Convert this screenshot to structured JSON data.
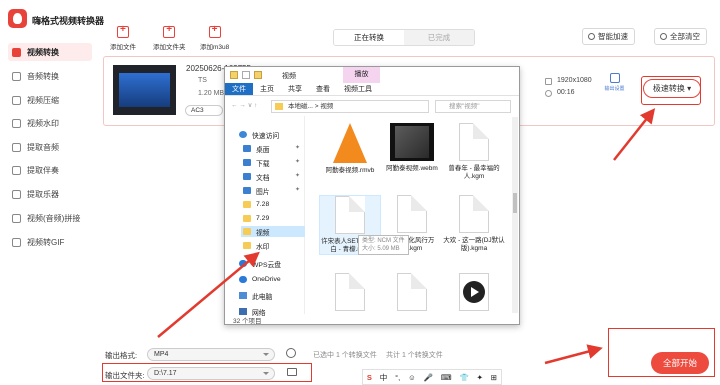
{
  "app": {
    "title": "嗨格式视频转换器"
  },
  "sidebar": {
    "items": [
      {
        "label": "视频转换",
        "active": true
      },
      {
        "label": "音频转换"
      },
      {
        "label": "视频压缩"
      },
      {
        "label": "视频水印"
      },
      {
        "label": "提取音频"
      },
      {
        "label": "提取伴奏"
      },
      {
        "label": "提取乐器"
      },
      {
        "label": "视频(音频)拼接"
      },
      {
        "label": "视频转GIF"
      }
    ]
  },
  "toolbar": {
    "add_file": "添加文件",
    "add_folder": "添加文件夹",
    "add_m3u8": "添加m3u8",
    "tab_converting": "正在转换",
    "tab_done": "已完成",
    "smart_accel": "智能加速",
    "clear_all": "全部清空"
  },
  "file": {
    "name": "20250626-162755",
    "type": "TS",
    "size": "1.20 MB",
    "codec": "AC3",
    "resolution": "1920x1080",
    "duration": "00:16",
    "output_settings": "输出设置",
    "fast_convert": "极速转换"
  },
  "bottom": {
    "format_label": "输出格式:",
    "format_value": "MP4",
    "folder_label": "输出文件夹:",
    "folder_value": "D:\\7.17",
    "selected_status": "已选中 1 个转换文件",
    "total_status": "共计 1 个转换文件",
    "start_all": "全部开始"
  },
  "ime": [
    "S",
    "中",
    "°,",
    "☺",
    "🎤",
    "⌨",
    "👕",
    "✦",
    "⊞"
  ],
  "explorer": {
    "title": "视频",
    "play_tab": "播放",
    "ribbon": [
      "文件",
      "主页",
      "共享",
      "查看",
      "视频工具"
    ],
    "path": [
      "本地磁...",
      "视频"
    ],
    "search_placeholder": "搜索\"视频\"",
    "nav": [
      {
        "label": "快速访问",
        "icon": "star-icon"
      },
      {
        "label": "桌面",
        "icon": "desktop-icon"
      },
      {
        "label": "下载",
        "icon": "download-icon"
      },
      {
        "label": "文档",
        "icon": "documents-icon"
      },
      {
        "label": "图片",
        "icon": "pictures-icon"
      },
      {
        "label": "7.28",
        "icon": "folder-icon"
      },
      {
        "label": "7.29",
        "icon": "folder-icon"
      },
      {
        "label": "视频",
        "icon": "folder-icon",
        "selected": true
      },
      {
        "label": "水印",
        "icon": "folder-icon"
      },
      {
        "label": "WPS云盘",
        "icon": "cloud-icon"
      },
      {
        "label": "OneDrive",
        "icon": "onedrive-icon"
      },
      {
        "label": "此电脑",
        "icon": "pc-icon"
      },
      {
        "label": "网络",
        "icon": "network-icon"
      }
    ],
    "files": [
      {
        "label": "阿勤泰视频.rmvb",
        "kind": "vlc"
      },
      {
        "label": "阿勤泰视频.webm",
        "kind": "video"
      },
      {
        "label": "曾春年 - 最幸福的人.kgm",
        "kind": "doc"
      },
      {
        "label": "许宋表人SET-B、木白 - 青檬.ncm",
        "kind": "doc",
        "selected": true
      },
      {
        "label": "大欢 - 化风行万里.kgm",
        "kind": "doc"
      },
      {
        "label": "大欢 - 这一路(DJ默认版).kgma",
        "kind": "doc"
      },
      {
        "label": "",
        "kind": "doc"
      },
      {
        "label": "",
        "kind": "doc"
      },
      {
        "label": "",
        "kind": "play"
      }
    ],
    "tooltip_type": "类型: NCM 文件",
    "tooltip_size": "大小: 5.09 MB",
    "item_count": "32 个项目"
  }
}
